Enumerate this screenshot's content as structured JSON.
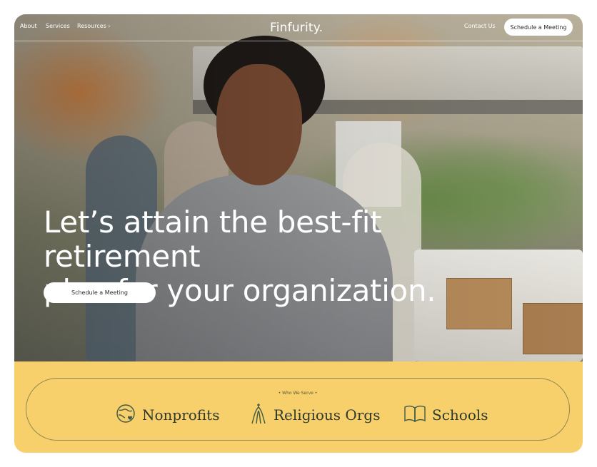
{
  "nav": {
    "links": [
      "About",
      "Services",
      "Resources ›"
    ],
    "logo": "Finfurity.",
    "contact": "Contact Us",
    "cta": "Schedule a Meeting"
  },
  "hero": {
    "headline_line1": "Let’s attain the best-fit retirement",
    "headline_line2": "plan for your organization.",
    "cta": "Schedule a Meeting"
  },
  "serve": {
    "label": "• Who We Serve •",
    "items": [
      {
        "label": "Nonprofits",
        "icon": "globe-heart-icon"
      },
      {
        "label": "Religious Orgs",
        "icon": "steeple-icon"
      },
      {
        "label": "Schools",
        "icon": "open-book-icon"
      }
    ]
  },
  "colors": {
    "accent_yellow": "#f7cf6b",
    "icon_green": "#3f5a44"
  }
}
